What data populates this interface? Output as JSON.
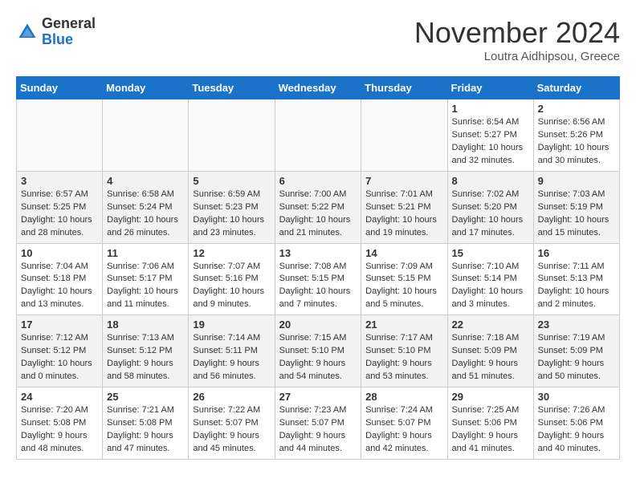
{
  "header": {
    "logo_general": "General",
    "logo_blue": "Blue",
    "month": "November 2024",
    "location": "Loutra Aidhipsou, Greece"
  },
  "weekdays": [
    "Sunday",
    "Monday",
    "Tuesday",
    "Wednesday",
    "Thursday",
    "Friday",
    "Saturday"
  ],
  "weeks": [
    [
      {
        "day": "",
        "detail": ""
      },
      {
        "day": "",
        "detail": ""
      },
      {
        "day": "",
        "detail": ""
      },
      {
        "day": "",
        "detail": ""
      },
      {
        "day": "",
        "detail": ""
      },
      {
        "day": "1",
        "detail": "Sunrise: 6:54 AM\nSunset: 5:27 PM\nDaylight: 10 hours\nand 32 minutes."
      },
      {
        "day": "2",
        "detail": "Sunrise: 6:56 AM\nSunset: 5:26 PM\nDaylight: 10 hours\nand 30 minutes."
      }
    ],
    [
      {
        "day": "3",
        "detail": "Sunrise: 6:57 AM\nSunset: 5:25 PM\nDaylight: 10 hours\nand 28 minutes."
      },
      {
        "day": "4",
        "detail": "Sunrise: 6:58 AM\nSunset: 5:24 PM\nDaylight: 10 hours\nand 26 minutes."
      },
      {
        "day": "5",
        "detail": "Sunrise: 6:59 AM\nSunset: 5:23 PM\nDaylight: 10 hours\nand 23 minutes."
      },
      {
        "day": "6",
        "detail": "Sunrise: 7:00 AM\nSunset: 5:22 PM\nDaylight: 10 hours\nand 21 minutes."
      },
      {
        "day": "7",
        "detail": "Sunrise: 7:01 AM\nSunset: 5:21 PM\nDaylight: 10 hours\nand 19 minutes."
      },
      {
        "day": "8",
        "detail": "Sunrise: 7:02 AM\nSunset: 5:20 PM\nDaylight: 10 hours\nand 17 minutes."
      },
      {
        "day": "9",
        "detail": "Sunrise: 7:03 AM\nSunset: 5:19 PM\nDaylight: 10 hours\nand 15 minutes."
      }
    ],
    [
      {
        "day": "10",
        "detail": "Sunrise: 7:04 AM\nSunset: 5:18 PM\nDaylight: 10 hours\nand 13 minutes."
      },
      {
        "day": "11",
        "detail": "Sunrise: 7:06 AM\nSunset: 5:17 PM\nDaylight: 10 hours\nand 11 minutes."
      },
      {
        "day": "12",
        "detail": "Sunrise: 7:07 AM\nSunset: 5:16 PM\nDaylight: 10 hours\nand 9 minutes."
      },
      {
        "day": "13",
        "detail": "Sunrise: 7:08 AM\nSunset: 5:15 PM\nDaylight: 10 hours\nand 7 minutes."
      },
      {
        "day": "14",
        "detail": "Sunrise: 7:09 AM\nSunset: 5:15 PM\nDaylight: 10 hours\nand 5 minutes."
      },
      {
        "day": "15",
        "detail": "Sunrise: 7:10 AM\nSunset: 5:14 PM\nDaylight: 10 hours\nand 3 minutes."
      },
      {
        "day": "16",
        "detail": "Sunrise: 7:11 AM\nSunset: 5:13 PM\nDaylight: 10 hours\nand 2 minutes."
      }
    ],
    [
      {
        "day": "17",
        "detail": "Sunrise: 7:12 AM\nSunset: 5:12 PM\nDaylight: 10 hours\nand 0 minutes."
      },
      {
        "day": "18",
        "detail": "Sunrise: 7:13 AM\nSunset: 5:12 PM\nDaylight: 9 hours\nand 58 minutes."
      },
      {
        "day": "19",
        "detail": "Sunrise: 7:14 AM\nSunset: 5:11 PM\nDaylight: 9 hours\nand 56 minutes."
      },
      {
        "day": "20",
        "detail": "Sunrise: 7:15 AM\nSunset: 5:10 PM\nDaylight: 9 hours\nand 54 minutes."
      },
      {
        "day": "21",
        "detail": "Sunrise: 7:17 AM\nSunset: 5:10 PM\nDaylight: 9 hours\nand 53 minutes."
      },
      {
        "day": "22",
        "detail": "Sunrise: 7:18 AM\nSunset: 5:09 PM\nDaylight: 9 hours\nand 51 minutes."
      },
      {
        "day": "23",
        "detail": "Sunrise: 7:19 AM\nSunset: 5:09 PM\nDaylight: 9 hours\nand 50 minutes."
      }
    ],
    [
      {
        "day": "24",
        "detail": "Sunrise: 7:20 AM\nSunset: 5:08 PM\nDaylight: 9 hours\nand 48 minutes."
      },
      {
        "day": "25",
        "detail": "Sunrise: 7:21 AM\nSunset: 5:08 PM\nDaylight: 9 hours\nand 47 minutes."
      },
      {
        "day": "26",
        "detail": "Sunrise: 7:22 AM\nSunset: 5:07 PM\nDaylight: 9 hours\nand 45 minutes."
      },
      {
        "day": "27",
        "detail": "Sunrise: 7:23 AM\nSunset: 5:07 PM\nDaylight: 9 hours\nand 44 minutes."
      },
      {
        "day": "28",
        "detail": "Sunrise: 7:24 AM\nSunset: 5:07 PM\nDaylight: 9 hours\nand 42 minutes."
      },
      {
        "day": "29",
        "detail": "Sunrise: 7:25 AM\nSunset: 5:06 PM\nDaylight: 9 hours\nand 41 minutes."
      },
      {
        "day": "30",
        "detail": "Sunrise: 7:26 AM\nSunset: 5:06 PM\nDaylight: 9 hours\nand 40 minutes."
      }
    ]
  ]
}
